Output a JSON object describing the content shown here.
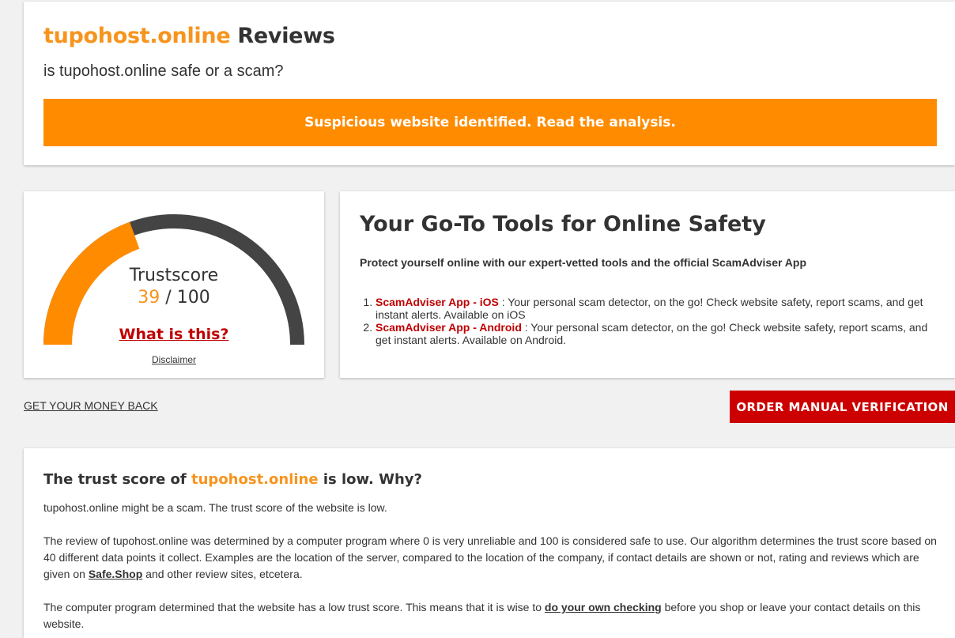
{
  "header": {
    "domain": "tupohost.online",
    "title_suffix": " Reviews",
    "subtitle": "is tupohost.online safe or a scam?",
    "alert": "Suspicious website identified. Read the analysis."
  },
  "score": {
    "label": "Trustscore",
    "value": 39,
    "max": " / 100",
    "what_link": "What is this?",
    "disclaimer": "Disclaimer",
    "colors": {
      "fill": "#ff8c00",
      "track": "#444444"
    }
  },
  "tools": {
    "title": "Your Go-To Tools for Online Safety",
    "intro": "Protect yourself online with our expert-vetted tools and the official ScamAdviser App",
    "items": [
      {
        "link": "ScamAdviser App - iOS",
        "text": " : Your personal scam detector, on the go! Check website safety, report scams, and get instant alerts. Available on iOS"
      },
      {
        "link": "ScamAdviser App - Android",
        "text": " : Your personal scam detector, on the go! Check website safety, report scams, and get instant alerts. Available on Android."
      }
    ]
  },
  "actions": {
    "money_back": "GET YOUR MONEY BACK",
    "order": "ORDER MANUAL VERIFICATION"
  },
  "why": {
    "title_prefix": "The trust score of ",
    "domain": "tupohost.online",
    "title_suffix": " is low. Why?",
    "p1": "tupohost.online might be a scam. The trust score of the website is low.",
    "p2a": "The review of tupohost.online was determined by a computer program where 0 is very unreliable and 100 is considered safe to use. Our algorithm determines the trust score based on 40 different data points it collect. Examples are the location of the server, compared to the location of the company, if contact details are shown or not, rating and reviews which are given on ",
    "p2_link": "Safe.Shop",
    "p2b": " and other review sites, etcetera.",
    "p3a": "The computer program determined that the website has a low trust score. This means that it is wise to ",
    "p3_link": "do your own checking",
    "p3b": " before you shop or leave your contact details on this website."
  },
  "colors": {
    "accent": "#f7941d",
    "alert_bg": "#ff8c00",
    "danger": "#cc0000"
  }
}
